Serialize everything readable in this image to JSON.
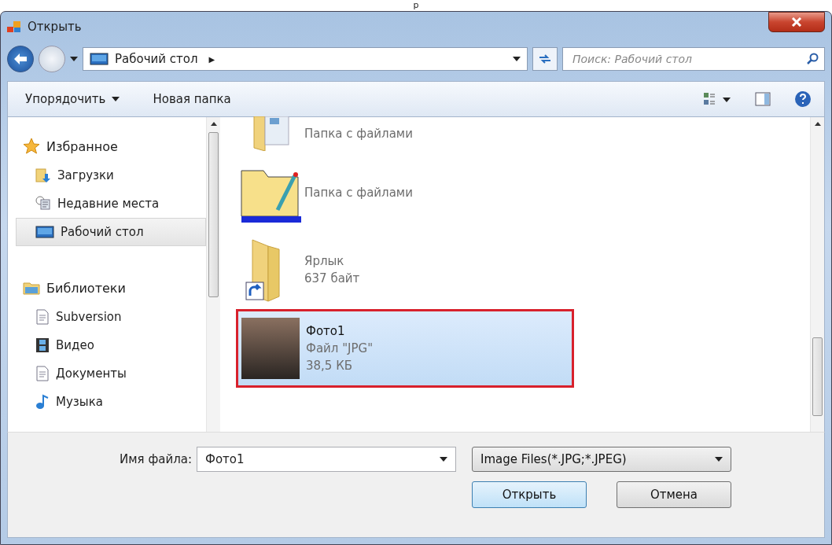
{
  "caption_fragment": "р",
  "window": {
    "title": "Открыть"
  },
  "address": {
    "location": "Рабочий стол",
    "separator": "▶"
  },
  "search": {
    "placeholder": "Поиск: Рабочий стол"
  },
  "toolbar": {
    "items": [
      {
        "label": "Упорядочить",
        "dropdown": true
      },
      {
        "label": "Новая папка",
        "dropdown": false
      }
    ]
  },
  "sidebar": {
    "groups": [
      {
        "label": "Избранное",
        "kind": "star",
        "children": [
          {
            "label": "Загрузки",
            "kind": "download-folder",
            "selected": false
          },
          {
            "label": "Недавние места",
            "kind": "recent",
            "selected": false
          },
          {
            "label": "Рабочий стол",
            "kind": "desktop",
            "selected": true
          }
        ]
      },
      {
        "label": "Библиотеки",
        "kind": "library",
        "children": [
          {
            "label": "Subversion",
            "kind": "document",
            "selected": false
          },
          {
            "label": "Видео",
            "kind": "film",
            "selected": false
          },
          {
            "label": "Документы",
            "kind": "document",
            "selected": false
          },
          {
            "label": "Музыка",
            "kind": "music",
            "selected": false
          }
        ]
      }
    ]
  },
  "files": [
    {
      "kind": "folder-partial",
      "lines": [
        "Папка с файлами"
      ],
      "selected": false
    },
    {
      "kind": "folder-pen",
      "lines": [
        "Папка с файлами"
      ],
      "selected": false
    },
    {
      "kind": "shortcut",
      "lines": [
        "Ярлык",
        "637 байт"
      ],
      "selected": false
    },
    {
      "kind": "photo",
      "lines": [
        "Фото1",
        "Файл \"JPG\"",
        "38,5 КБ"
      ],
      "selected": true
    }
  ],
  "filename": {
    "label": "Имя файла:",
    "value": "Фото1"
  },
  "filter": {
    "value": "Image Files(*.JPG;*.JPEG)"
  },
  "buttons": [
    {
      "label": "Открыть",
      "default": true
    },
    {
      "label": "Отмена",
      "default": false
    }
  ]
}
